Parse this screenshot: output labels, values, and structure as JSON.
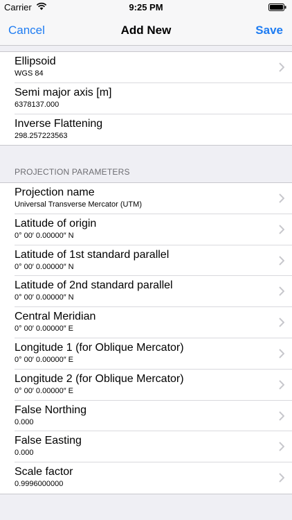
{
  "status": {
    "carrier": "Carrier",
    "time": "9:25 PM"
  },
  "nav": {
    "cancel": "Cancel",
    "title": "Add New",
    "save": "Save"
  },
  "ellipsoid_group": [
    {
      "title": "Ellipsoid",
      "value": "WGS 84",
      "chevron": true
    },
    {
      "title": "Semi major axis [m]",
      "value": "6378137.000",
      "chevron": false
    },
    {
      "title": "Inverse Flattening",
      "value": "298.257223563",
      "chevron": false
    }
  ],
  "projection_header": "PROJECTION PARAMETERS",
  "projection_group": [
    {
      "title": "Projection name",
      "value": "Universal Transverse Mercator (UTM)",
      "chevron": true
    },
    {
      "title": "Latitude of origin",
      "value": "0° 00′ 0.00000″ N",
      "chevron": true
    },
    {
      "title": "Latitude of 1st standard parallel",
      "value": "0° 00′ 0.00000″ N",
      "chevron": true
    },
    {
      "title": "Latitude of 2nd standard parallel",
      "value": "0° 00′ 0.00000″ N",
      "chevron": true
    },
    {
      "title": "Central Meridian",
      "value": "0° 00′ 0.00000″ E",
      "chevron": true
    },
    {
      "title": "Longitude 1 (for Oblique Mercator)",
      "value": "0° 00′ 0.00000″ E",
      "chevron": true
    },
    {
      "title": "Longitude 2 (for Oblique Mercator)",
      "value": "0° 00′ 0.00000″ E",
      "chevron": true
    },
    {
      "title": "False Northing",
      "value": "0.000",
      "chevron": true
    },
    {
      "title": "False Easting",
      "value": "0.000",
      "chevron": true
    },
    {
      "title": "Scale factor",
      "value": "0.9996000000",
      "chevron": true
    }
  ],
  "colors": {
    "accent": "#1e7cf2",
    "background": "#efeff4",
    "chevron": "#c7c7cc"
  }
}
